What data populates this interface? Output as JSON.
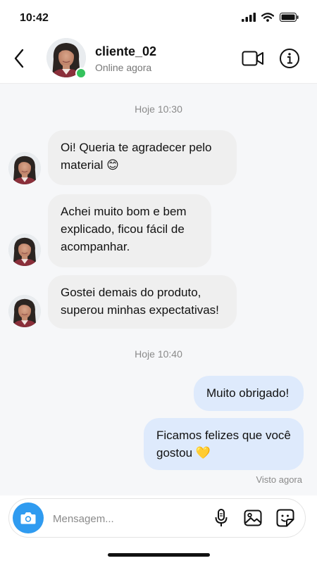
{
  "status_bar": {
    "time": "10:42"
  },
  "header": {
    "contact_name": "cliente_02",
    "contact_status": "Online agora"
  },
  "chat": {
    "timestamp_1": "Hoje 10:30",
    "incoming_1": "Oi! Queria te agradecer pelo\nmaterial 😊",
    "incoming_2": "Achei muito bom e bem\nexplicado, ficou fácil de\nacompanhar.",
    "incoming_3": "Gostei demais do produto,\nsuperou minhas expectativas!",
    "timestamp_2": "Hoje 10:40",
    "outgoing_1": "Muito obrigado!",
    "outgoing_2": "Ficamos felizes que você\ngostou 💛",
    "seen_label": "Visto agora"
  },
  "composer": {
    "placeholder": "Mensagem..."
  },
  "colors": {
    "accent": "#2f9bf0",
    "online": "#35c25d",
    "incoming_bubble": "#efefef",
    "outgoing_bubble": "#deeafc"
  },
  "icons": [
    "back-arrow-icon",
    "video-camera-icon",
    "info-icon",
    "camera-icon",
    "microphone-icon",
    "image-icon",
    "sticker-icon"
  ]
}
